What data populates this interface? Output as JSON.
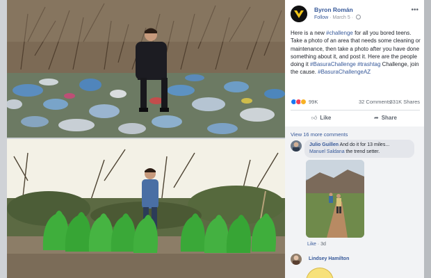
{
  "post": {
    "author": "Byron Román",
    "follow_label": "Follow",
    "separator": "·",
    "date": "March 5",
    "more_icon": "ellipsis-icon",
    "text_1": "Here is a new ",
    "hashtag_challenge": "#challenge",
    "text_2": " for all you bored teens. Take a photo of an area that needs some cleaning or maintenance, then take a photo after you have done something about it, and post it. Here are the people doing it ",
    "hashtag_basura": "#BasuraChallenge",
    "text_3": " ",
    "hashtag_trash": "#trashtag",
    "text_4": " Challenge, join the cause. ",
    "hashtag_az": "#BasuraChallengeAZ"
  },
  "stats": {
    "reactions": "99K",
    "comments": "32 Comments",
    "shares": "331K Shares"
  },
  "actions": {
    "like": "Like",
    "share": "Share"
  },
  "comments": {
    "view_more": "View 16 more comments",
    "items": [
      {
        "author": "Julio Guillen",
        "text": " And do it for 13 miles...",
        "tagged": "Manuel Saldana",
        "text_2": " the trend setter.",
        "like_label": "Like",
        "dot": "·",
        "time": "3d"
      },
      {
        "author": "Lindsey Hamilton"
      }
    ]
  },
  "colors": {
    "link": "#365899",
    "like_reaction": "#1877f2",
    "love_reaction": "#f33e58",
    "wow_reaction": "#f7b125",
    "trash_bag_green": "#3fae3c"
  }
}
